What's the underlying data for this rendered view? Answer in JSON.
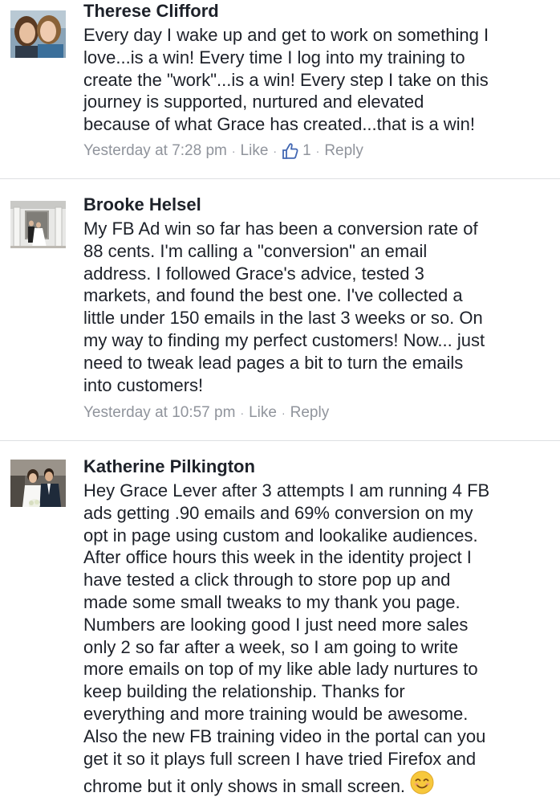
{
  "comments": [
    {
      "author": "Therese Clifford",
      "lines": [
        "Every day I wake up and get to work on something I",
        "love...is a win! Every time I log into my training to",
        "create the \"work\"...is a win! Every step I take on this",
        "journey is supported, nurtured and elevated",
        "because of what Grace has created...that is a win!"
      ],
      "timestamp": "Yesterday at 7:28 pm",
      "like_label": "Like",
      "like_count": "1",
      "reply_label": "Reply",
      "separator": "·"
    },
    {
      "author": "Brooke Helsel",
      "lines": [
        "My FB Ad win so far has been a conversion rate of",
        "88 cents. I'm calling a \"conversion\" an email",
        "address. I followed Grace's advice, tested 3",
        "markets, and found the best one. I've collected a",
        "little under 150 emails in the last 3 weeks or so. On",
        "my way to finding my perfect customers! Now... just",
        "need to tweak lead pages a bit to turn the emails",
        "into customers!"
      ],
      "timestamp": "Yesterday at 10:57 pm",
      "like_label": "Like",
      "reply_label": "Reply",
      "separator": "·"
    },
    {
      "author": "Katherine Pilkington",
      "lines": [
        "Hey Grace Lever after 3 attempts I am running 4 FB",
        "ads getting .90 emails and 69% conversion on my",
        "opt in page using custom and lookalike audiences.",
        "After office hours this week in the identity project I",
        "have tested a click through to store pop up  and",
        "made some small tweaks to my thank you page.",
        "Numbers are looking good I just need more sales",
        "only 2 so far after a week, so I am going to write",
        "more emails on top of my like able lady  nurtures to",
        "keep building the relationship. Thanks for",
        "everything and more training would be awesome.",
        "Also the new FB training video in the portal can you",
        "get it so it plays full screen I have tried Firefox and",
        "chrome but it only shows in small screen."
      ],
      "emoji": "smiling-face-emoji"
    }
  ],
  "colors": {
    "text": "#1d2129",
    "meta": "#90949c",
    "divider": "#dddfe2",
    "like_icon": "#4267b2",
    "emoji": "#f7c83c"
  },
  "icons": {
    "like": "thumbs-up-icon"
  }
}
